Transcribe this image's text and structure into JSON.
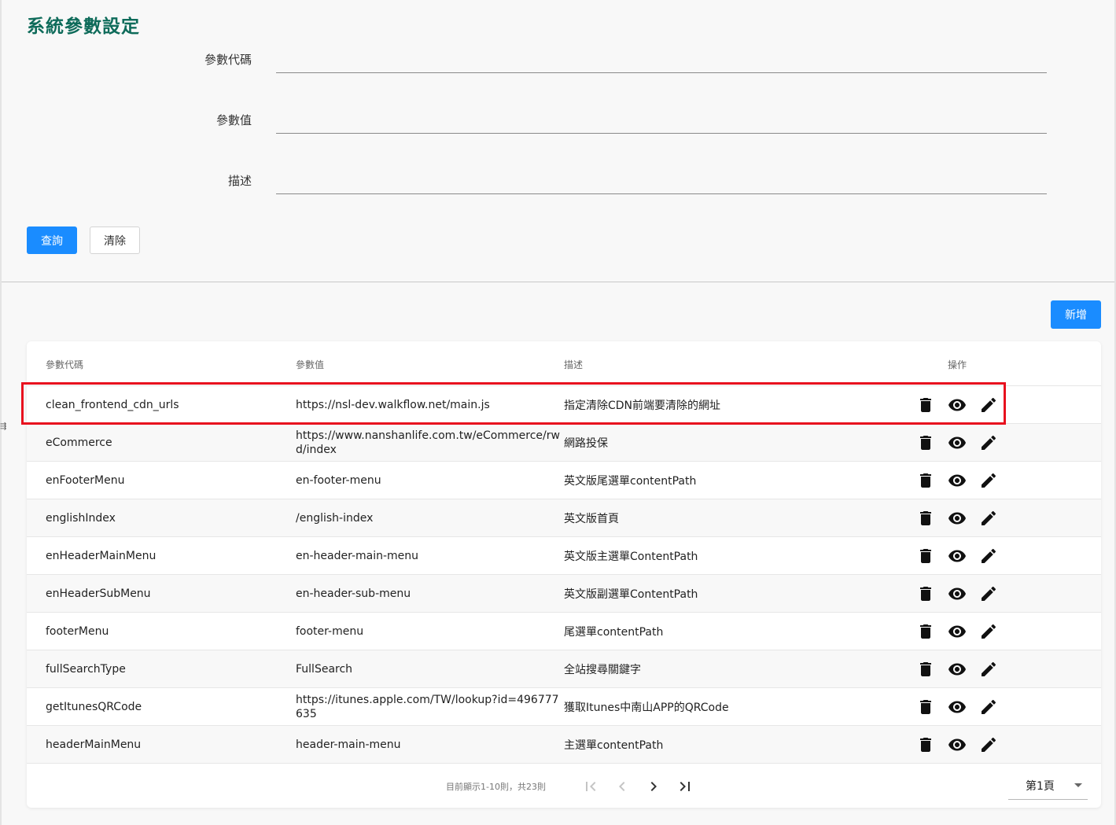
{
  "page": {
    "title": "系統參數設定"
  },
  "search_form": {
    "code_label": "參數代碼",
    "code_value": "",
    "value_label": "參數值",
    "value_value": "",
    "desc_label": "描述",
    "desc_value": "",
    "query_button": "查詢",
    "clear_button": "清除"
  },
  "toolbar": {
    "add_button": "新增"
  },
  "table": {
    "headers": {
      "code": "參數代碼",
      "value": "參數值",
      "description": "描述",
      "actions": "操作"
    },
    "highlighted_row": 0,
    "rows": [
      {
        "code": "clean_frontend_cdn_urls",
        "value": "https://nsl-dev.walkflow.net/main.js",
        "description": "指定清除CDN前端要清除的網址"
      },
      {
        "code": "eCommerce",
        "value": "https://www.nanshanlife.com.tw/eCommerce/rwd/index",
        "description": "網路投保"
      },
      {
        "code": "enFooterMenu",
        "value": "en-footer-menu",
        "description": "英文版尾選單contentPath"
      },
      {
        "code": "englishIndex",
        "value": "/english-index",
        "description": "英文版首頁"
      },
      {
        "code": "enHeaderMainMenu",
        "value": "en-header-main-menu",
        "description": "英文版主選單ContentPath"
      },
      {
        "code": "enHeaderSubMenu",
        "value": "en-header-sub-menu",
        "description": "英文版副選單ContentPath"
      },
      {
        "code": "footerMenu",
        "value": "footer-menu",
        "description": "尾選單contentPath"
      },
      {
        "code": "fullSearchType",
        "value": "FullSearch",
        "description": "全站搜尋關鍵字"
      },
      {
        "code": "getItunesQRCode",
        "value": "https://itunes.apple.com/TW/lookup?id=496777635",
        "description": "獲取Itunes中南山APP的QRCode"
      },
      {
        "code": "headerMainMenu",
        "value": "header-main-menu",
        "description": "主選單contentPath"
      }
    ],
    "row_actions": {
      "delete_icon": "trash-icon",
      "view_icon": "eye-icon",
      "edit_icon": "pencil-icon"
    }
  },
  "pagination": {
    "info": "目前顯示1-10則，共23則",
    "current_page_label": "第1頁",
    "icons": [
      "first-page-icon",
      "prev-page-icon",
      "next-page-icon",
      "last-page-icon"
    ]
  },
  "colors": {
    "title": "#0e6b5a",
    "primary": "#1a8cff",
    "highlight_border": "#e8101e"
  }
}
